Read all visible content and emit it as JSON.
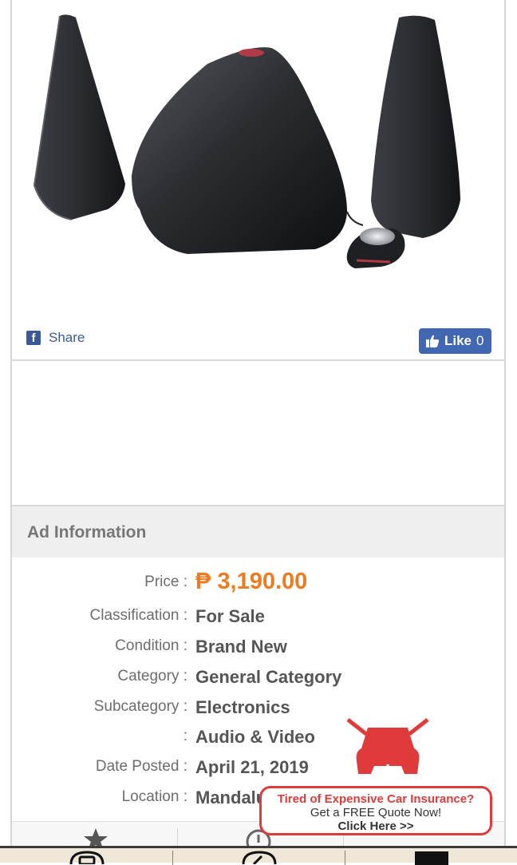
{
  "share_bar": {
    "share_label": "Share",
    "like_label": "Like",
    "like_count": "0"
  },
  "ad_info": {
    "header": "Ad Information",
    "rows": [
      {
        "label": "Price :",
        "value": "₱ 3,190.00"
      },
      {
        "label": "Classification :",
        "value": "For Sale"
      },
      {
        "label": "Condition :",
        "value": "Brand New"
      },
      {
        "label": "Category :",
        "value": "General Category"
      },
      {
        "label": "Subcategory :",
        "value": "Electronics"
      },
      {
        "label": ":",
        "value": "Audio & Video"
      },
      {
        "label": "Date Posted :",
        "value": "April 21, 2019"
      },
      {
        "label": "Location :",
        "value": "Mandaluyong"
      }
    ]
  },
  "promo": {
    "line1": "Tired of Expensive Car Insurance?",
    "line2": "Get a FREE Quote Now!",
    "line3": "Click Here >>"
  },
  "icons": {
    "share": "facebook-icon",
    "like": "thumbs-up-icon",
    "tab1": "star-icon",
    "tab2": "report-icon",
    "nav1": "message-icon",
    "nav2": "edit-icon",
    "nav3": "account-icon"
  },
  "colors": {
    "price": "#f07a1e",
    "facebook": "#4267b2",
    "promo": "#e03b3b"
  }
}
